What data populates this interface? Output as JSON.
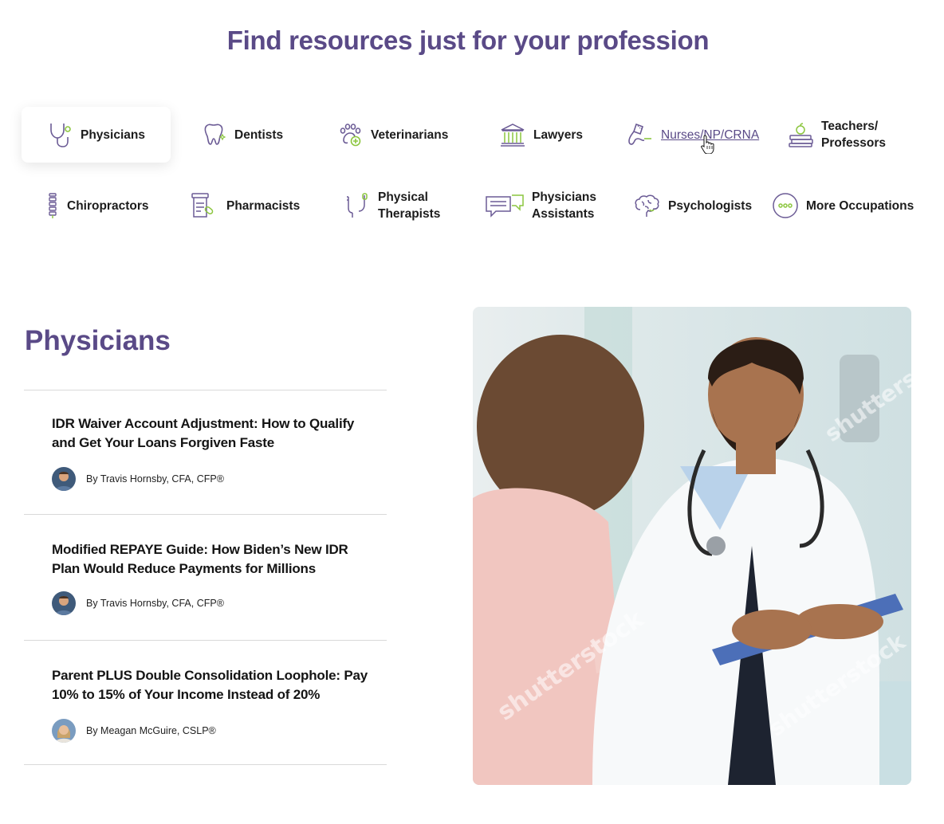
{
  "header": {
    "title": "Find resources just for your profession"
  },
  "professions": [
    {
      "label": "Physicians",
      "icon": "stethoscope-icon",
      "active": true
    },
    {
      "label": "Dentists",
      "icon": "tooth-icon"
    },
    {
      "label": "Veterinarians",
      "icon": "paw-icon"
    },
    {
      "label": "Lawyers",
      "icon": "courthouse-icon"
    },
    {
      "label": "Nurses/NP/CRNA",
      "icon": "nurse-icon",
      "hovered": true
    },
    {
      "label": "Teachers/ Professors",
      "icon": "books-apple-icon"
    },
    {
      "label": "Chiropractors",
      "icon": "spine-icon"
    },
    {
      "label": "Pharmacists",
      "icon": "prescription-icon"
    },
    {
      "label": "Physical Therapists",
      "icon": "therapy-bands-icon"
    },
    {
      "label": "Physicians Assistants",
      "icon": "chat-bubbles-icon"
    },
    {
      "label": "Psychologists",
      "icon": "brain-icon"
    },
    {
      "label": "More Occupations",
      "icon": "more-dots-icon"
    }
  ],
  "section": {
    "title": "Physicians"
  },
  "articles": [
    {
      "title": "IDR Waiver Account Adjustment: How to Qualify and Get Your Loans Forgiven Faste",
      "author": "By Travis Hornsby, CFA, CFP®"
    },
    {
      "title": "Modified REPAYE Guide: How Biden’s New IDR Plan Would Reduce Payments for Millions",
      "author": "By Travis Hornsby, CFA, CFP®"
    },
    {
      "title": "Parent PLUS Double Consolidation Loophole: Pay 10% to 15% of Your Income Instead of 20%",
      "author": "By Meagan McGuire, CSLP®"
    }
  ],
  "photo": {
    "watermark": "shutterstock"
  },
  "colors": {
    "brand": "#5a4a87",
    "icon_purple": "#6b5b95",
    "icon_green": "#8cc63f"
  }
}
